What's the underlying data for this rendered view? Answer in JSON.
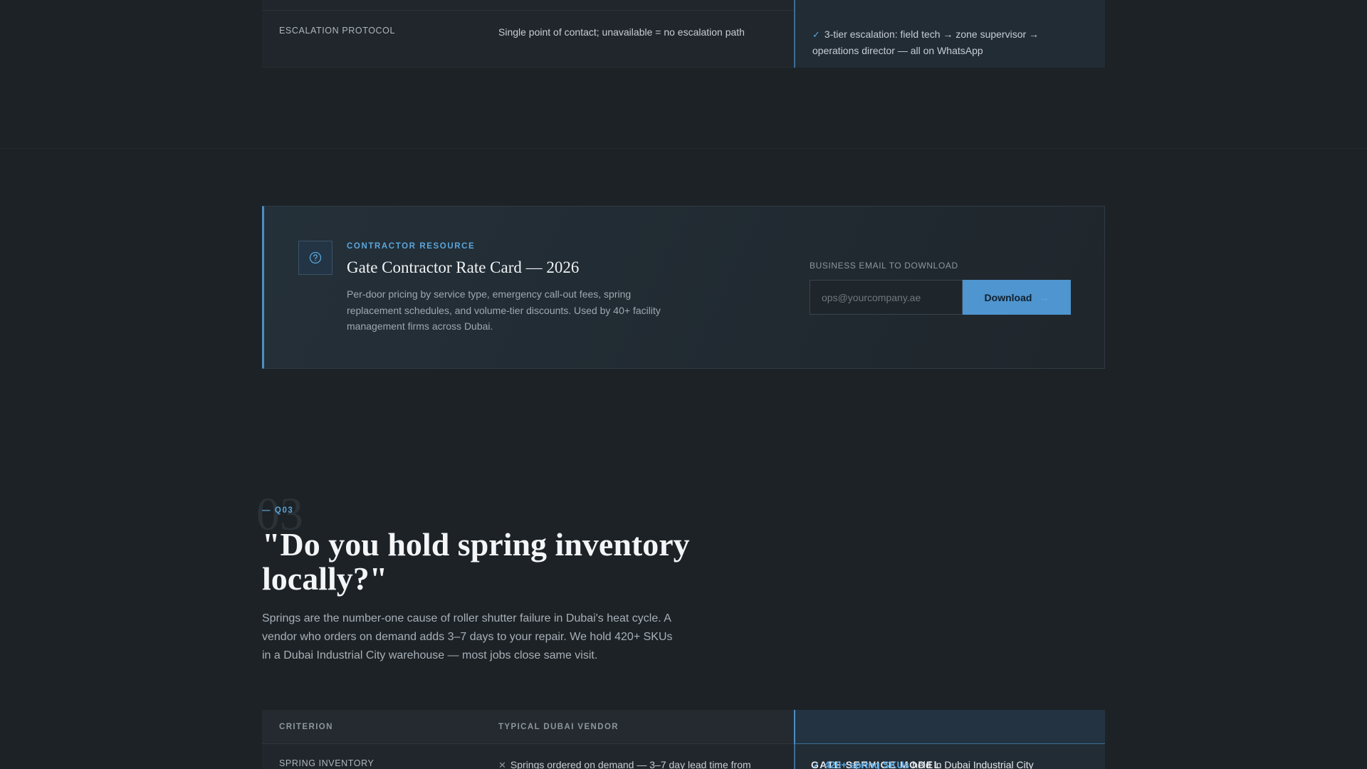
{
  "top_table": {
    "row": {
      "criterion": "ESCALATION PROTOCOL",
      "vendor": "Single point of contact; unavailable = no escalation path",
      "gate": "3-tier escalation: field tech → zone supervisor → operations director — all on WhatsApp"
    }
  },
  "resource_card": {
    "eyebrow": "CONTRACTOR RESOURCE",
    "title": "Gate Contractor Rate Card — 2026",
    "description": "Per-door pricing by service type, emergency call-out fees, spring replacement schedules, and volume-tier discounts. Used by 40+ facility management firms across Dubai.",
    "email_label": "BUSINESS EMAIL TO DOWNLOAD",
    "email_placeholder": "ops@yourcompany.ae",
    "download_label": "Download",
    "icon": "question-circle-icon"
  },
  "question": {
    "number": "03",
    "tag": "— Q03",
    "title": "\"Do you hold spring inventory locally?\"",
    "body": "Springs are the number-one cause of roller shutter failure in Dubai's heat cycle. A vendor who orders on demand adds 3–7 days to your repair. We hold 420+ SKUs in a Dubai Industrial City warehouse — most jobs close same visit."
  },
  "bottom_table": {
    "headers": {
      "criterion": "CRITERION",
      "vendor": "TYPICAL DUBAI VENDOR",
      "gate": "GATE SERVICE MODEL"
    },
    "row": {
      "criterion": "SPRING INVENTORY",
      "vendor": "Springs ordered on demand — 3–7 day lead time from",
      "gate_highlight": "420+ spring SKUs",
      "gate_rest": "held in Dubai Industrial City"
    }
  },
  "colors": {
    "background": "#1d2226",
    "accent": "#5aa6dc",
    "button": "#4f95cf"
  }
}
